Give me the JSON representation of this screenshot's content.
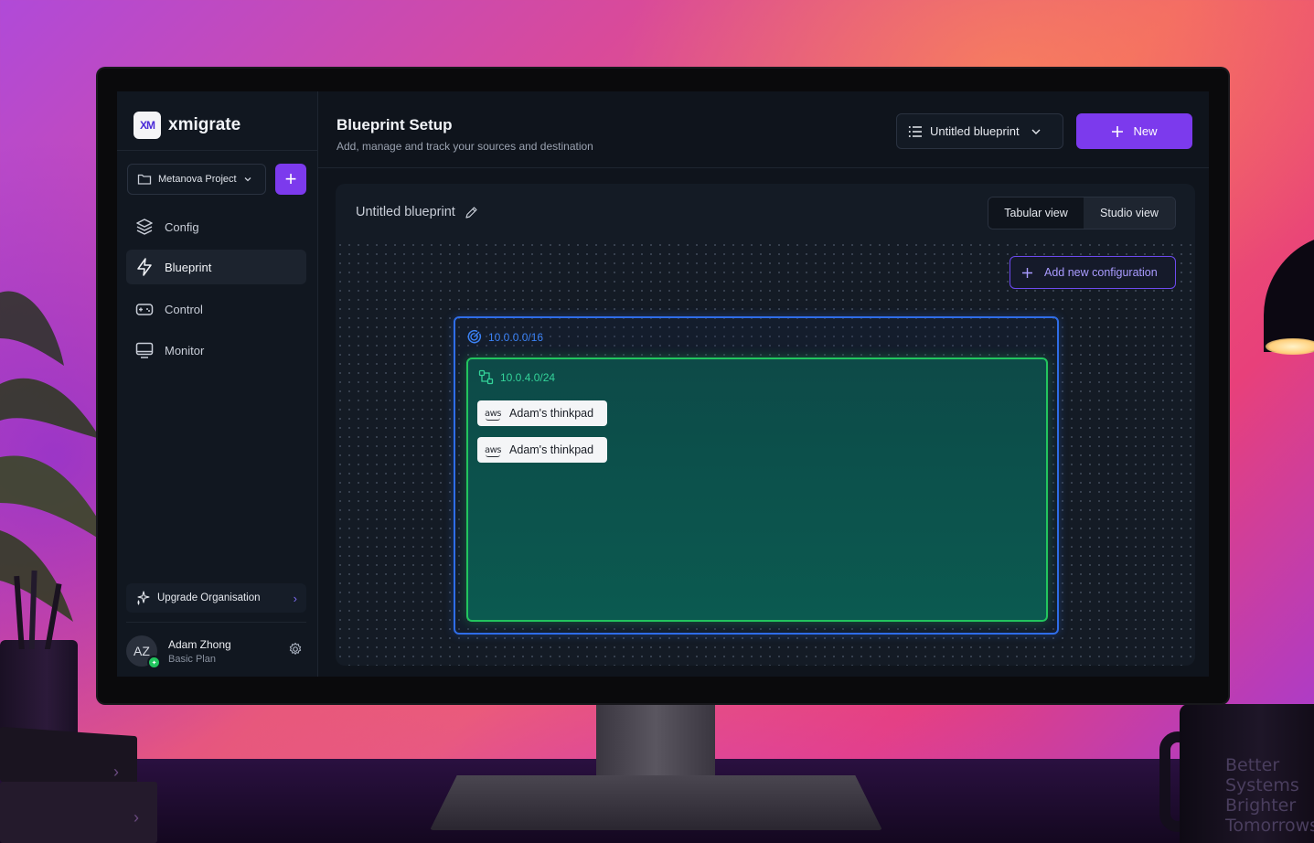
{
  "app": {
    "logo_text": "XM",
    "name": "xmigrate"
  },
  "sidebar": {
    "project": "Metanova Project",
    "project_add": "+",
    "items": [
      {
        "label": "Config",
        "icon": "layers-icon"
      },
      {
        "label": "Blueprint",
        "icon": "bolt-icon",
        "active": true
      },
      {
        "label": "Control",
        "icon": "gamepad-icon"
      },
      {
        "label": "Monitor",
        "icon": "monitor-icon"
      }
    ],
    "upgrade_label": "Upgrade Organisation",
    "user": {
      "initials": "AZ",
      "name": "Adam Zhong",
      "plan": "Basic Plan"
    }
  },
  "header": {
    "title": "Blueprint Setup",
    "subtitle": "Add, manage and track your sources and destination",
    "blueprint_select": "Untitled blueprint",
    "new_button": "New"
  },
  "canvas": {
    "blueprint_name": "Untitled blueprint",
    "views": [
      "Tabular view",
      "Studio view"
    ],
    "active_view": "Studio view",
    "add_config_label": "Add new configuration",
    "vpc": {
      "cidr": "10.0.0.0/16",
      "subnet": {
        "cidr": "10.0.4.0/24",
        "instances": [
          {
            "provider": "aws",
            "name": "Adam's thinkpad"
          },
          {
            "provider": "aws",
            "name": "Adam's thinkpad"
          }
        ]
      }
    }
  },
  "scene": {
    "mug_text": [
      "Better",
      "Systems",
      "Brighter",
      "Tomorrows"
    ]
  },
  "colors": {
    "accent": "#7c3aed",
    "vpc_border": "#2f6de8",
    "subnet_border": "#22c55e"
  }
}
